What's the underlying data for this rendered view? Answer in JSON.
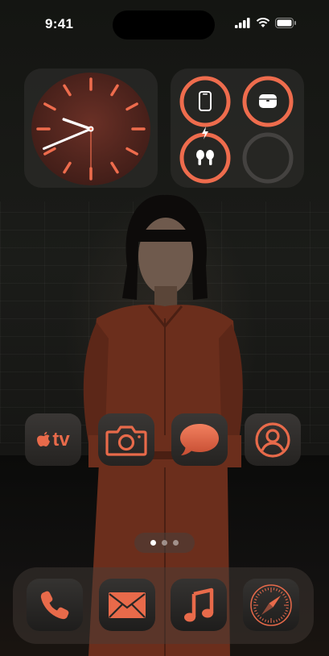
{
  "status_bar": {
    "time": "9:41"
  },
  "clock": {
    "hour": 9,
    "minute": 41
  },
  "battery": {
    "devices": [
      {
        "name": "phone-icon",
        "level": 1.0,
        "charging": false
      },
      {
        "name": "airpods-case-icon",
        "level": 1.0,
        "charging": false
      },
      {
        "name": "airpods-icon",
        "level": 1.0,
        "charging": true
      },
      {
        "name": "empty-slot",
        "level": 0,
        "charging": false
      }
    ]
  },
  "apps": [
    {
      "icon": "apple-tv-icon",
      "label": "tv"
    },
    {
      "icon": "camera-icon"
    },
    {
      "icon": "messages-icon"
    },
    {
      "icon": "contacts-icon"
    }
  ],
  "dock": [
    {
      "icon": "phone-icon"
    },
    {
      "icon": "mail-icon"
    },
    {
      "icon": "music-icon"
    },
    {
      "icon": "safari-icon"
    }
  ],
  "pager": {
    "pages": 3,
    "current": 1
  },
  "colors": {
    "accent": "#ee6c4d",
    "accent_dark": "#5a2a22",
    "widget_bg": "#282826"
  }
}
